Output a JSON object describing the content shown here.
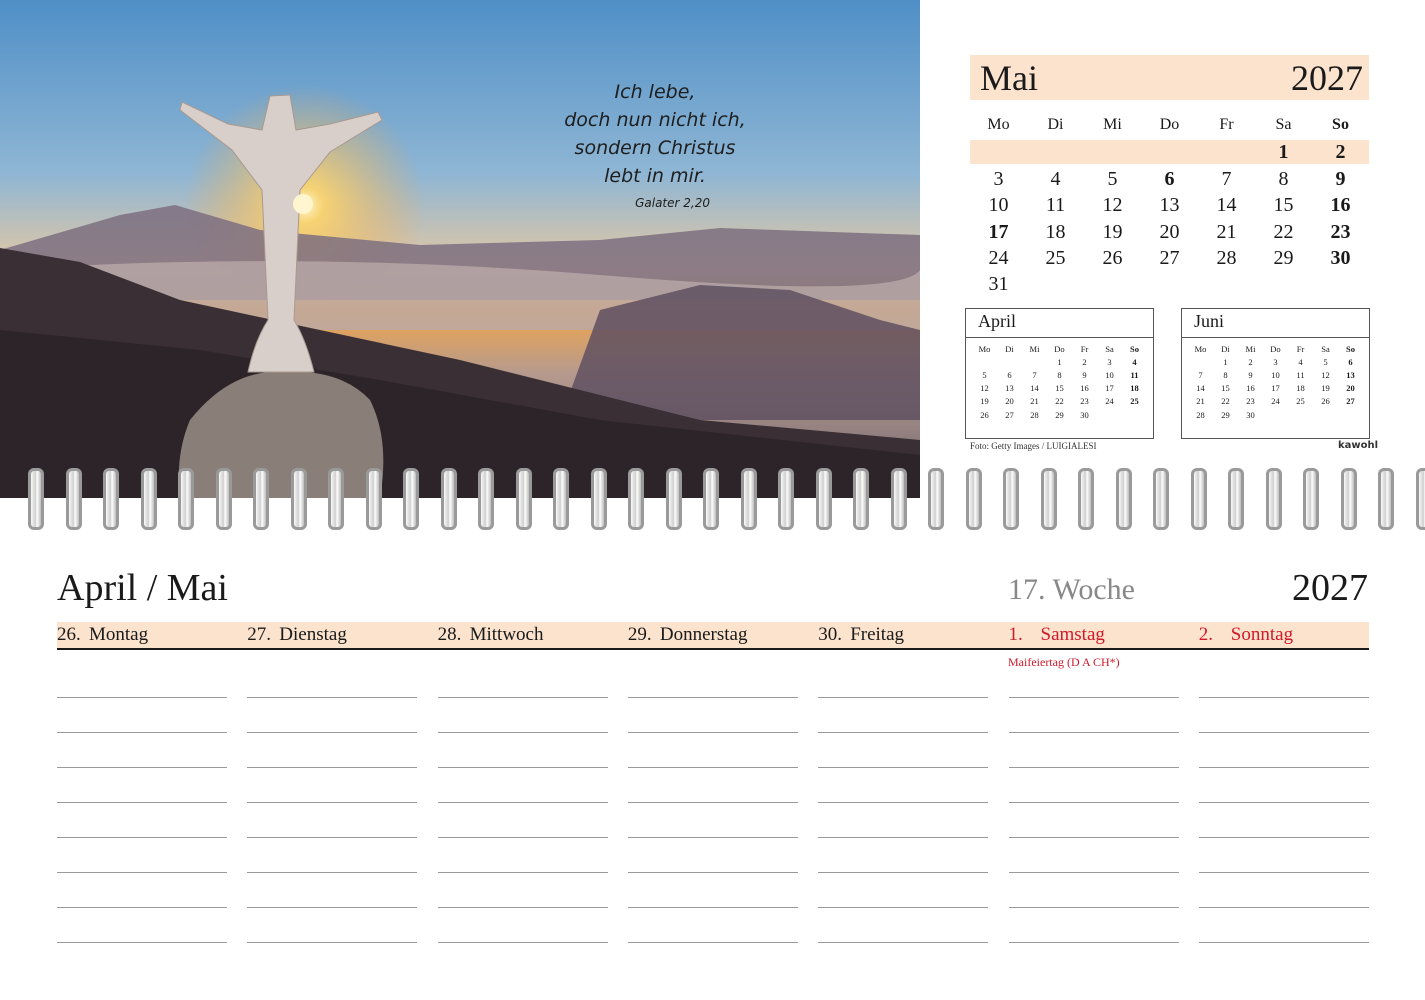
{
  "photo": {
    "quote_lines": [
      "Ich lebe,",
      "doch nun nicht ich,",
      "sondern Christus",
      "lebt in mir."
    ],
    "quote_reference": "Galater 2,20",
    "credit": "Foto: Getty Images / LUIGIALESI",
    "brand": "kawohl"
  },
  "month_calendar": {
    "month": "Mai",
    "year": "2027",
    "weekdays": [
      "Mo",
      "Di",
      "Mi",
      "Do",
      "Fr",
      "Sa",
      "So"
    ],
    "weeks": [
      [
        "",
        "",
        "",
        "",
        "",
        "1",
        "2"
      ],
      [
        "3",
        "4",
        "5",
        "6",
        "7",
        "8",
        "9"
      ],
      [
        "10",
        "11",
        "12",
        "13",
        "14",
        "15",
        "16"
      ],
      [
        "17",
        "18",
        "19",
        "20",
        "21",
        "22",
        "23"
      ],
      [
        "24",
        "25",
        "26",
        "27",
        "28",
        "29",
        "30"
      ],
      [
        "31",
        "",
        "",
        "",
        "",
        "",
        ""
      ]
    ],
    "bold_days": [
      "1",
      "2",
      "6",
      "9",
      "16",
      "17",
      "23",
      "30"
    ]
  },
  "mini_calendars": [
    {
      "month": "April",
      "weekdays": [
        "Mo",
        "Di",
        "Mi",
        "Do",
        "Fr",
        "Sa",
        "So"
      ],
      "weeks": [
        [
          "",
          "",
          "",
          "1",
          "2",
          "3",
          "4"
        ],
        [
          "5",
          "6",
          "7",
          "8",
          "9",
          "10",
          "11"
        ],
        [
          "12",
          "13",
          "14",
          "15",
          "16",
          "17",
          "18"
        ],
        [
          "19",
          "20",
          "21",
          "22",
          "23",
          "24",
          "25"
        ],
        [
          "26",
          "27",
          "28",
          "29",
          "30",
          "",
          ""
        ]
      ],
      "bold_days": [
        "4",
        "11",
        "18",
        "25"
      ]
    },
    {
      "month": "Juni",
      "weekdays": [
        "Mo",
        "Di",
        "Mi",
        "Do",
        "Fr",
        "Sa",
        "So"
      ],
      "weeks": [
        [
          "",
          "1",
          "2",
          "3",
          "4",
          "5",
          "6"
        ],
        [
          "7",
          "8",
          "9",
          "10",
          "11",
          "12",
          "13"
        ],
        [
          "14",
          "15",
          "16",
          "17",
          "18",
          "19",
          "20"
        ],
        [
          "21",
          "22",
          "23",
          "24",
          "25",
          "26",
          "27"
        ],
        [
          "28",
          "29",
          "30",
          "",
          "",
          "",
          ""
        ]
      ],
      "bold_days": [
        "6",
        "13",
        "20",
        "27"
      ]
    }
  ],
  "planner": {
    "title": "April / Mai",
    "week": "17. Woche",
    "year": "2027",
    "days": [
      {
        "num": "26.",
        "name": "Montag",
        "holiday": false
      },
      {
        "num": "27.",
        "name": "Dienstag",
        "holiday": false
      },
      {
        "num": "28.",
        "name": "Mittwoch",
        "holiday": false
      },
      {
        "num": "29.",
        "name": "Donnerstag",
        "holiday": false
      },
      {
        "num": "30.",
        "name": "Freitag",
        "holiday": false
      },
      {
        "num": "1.",
        "name": "Samstag",
        "holiday": true
      },
      {
        "num": "2.",
        "name": "Sonntag",
        "holiday": true
      }
    ],
    "holiday_note": "Maifeiertag (D A CH*)",
    "red_color": "#d0192b",
    "accent_color": "#fce3cd"
  }
}
